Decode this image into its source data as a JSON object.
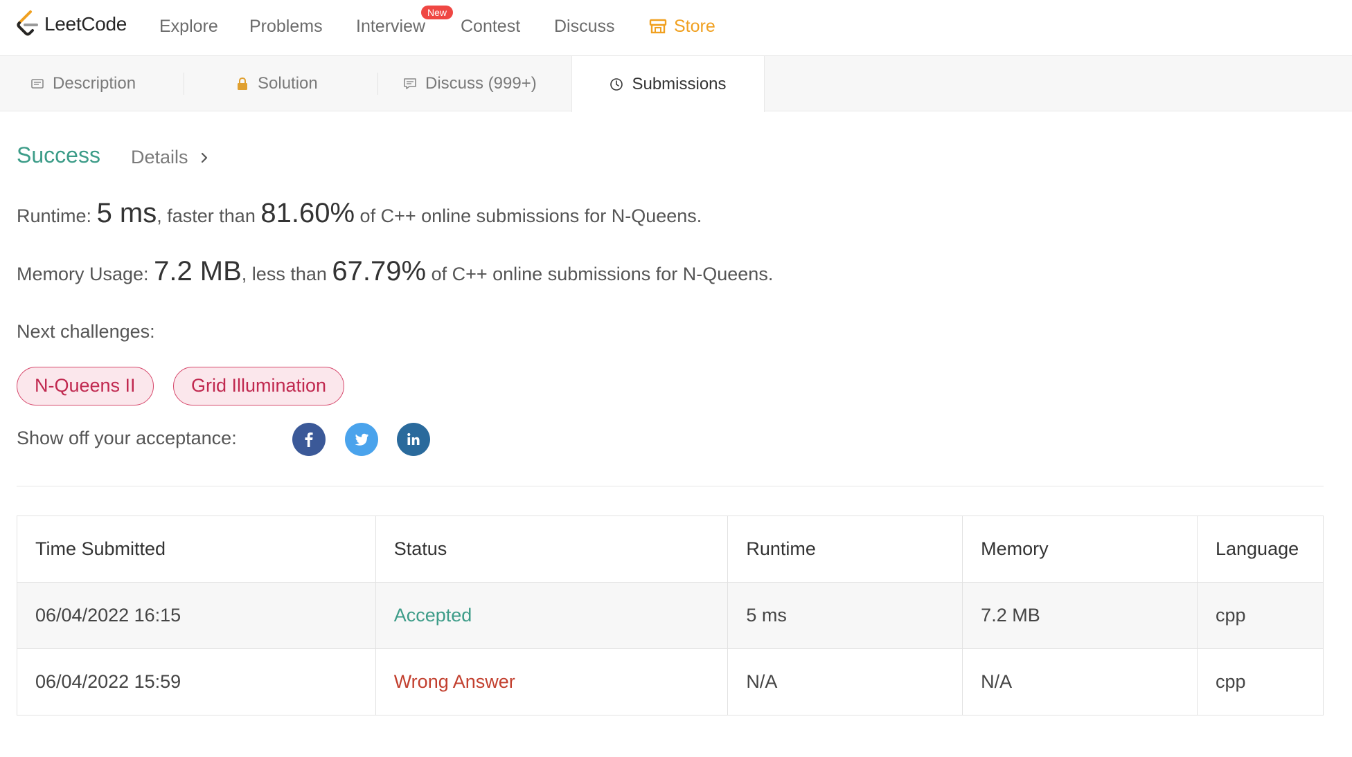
{
  "nav": {
    "logo_text": "LeetCode",
    "items": [
      "Explore",
      "Problems",
      "Interview",
      "Contest",
      "Discuss",
      "Store"
    ],
    "interview_badge": "New",
    "store_color": "#f0a020"
  },
  "tabs": {
    "description": "Description",
    "solution": "Solution",
    "discuss": "Discuss (999+)",
    "submissions": "Submissions"
  },
  "result": {
    "status": "Success",
    "details": "Details",
    "runtime_label": "Runtime:",
    "runtime_value": "5 ms",
    "runtime_mid": ", faster than",
    "runtime_pct": "81.60%",
    "runtime_suffix": "of C++ online submissions for N-Queens.",
    "memory_label": "Memory Usage:",
    "memory_value": "7.2 MB",
    "memory_mid": ", less than",
    "memory_pct": "67.79%",
    "memory_suffix": "of C++ online submissions for N-Queens."
  },
  "next": {
    "label": "Next challenges:",
    "challenges": [
      "N-Queens II",
      "Grid Illumination"
    ]
  },
  "share": {
    "label": "Show off your acceptance:",
    "icons": [
      "facebook-icon",
      "twitter-icon",
      "linkedin-icon"
    ]
  },
  "table": {
    "headers": [
      "Time Submitted",
      "Status",
      "Runtime",
      "Memory",
      "Language"
    ],
    "rows": [
      [
        "06/04/2022 16:15",
        "Accepted",
        "5 ms",
        "7.2 MB",
        "cpp"
      ],
      [
        "06/04/2022 15:59",
        "Wrong Answer",
        "N/A",
        "N/A",
        "cpp"
      ]
    ]
  },
  "colors": {
    "success": "#3c9c88",
    "wrong": "#c23f2e",
    "chip_border": "#d6466a",
    "chip_bg": "#fbe7ec"
  }
}
